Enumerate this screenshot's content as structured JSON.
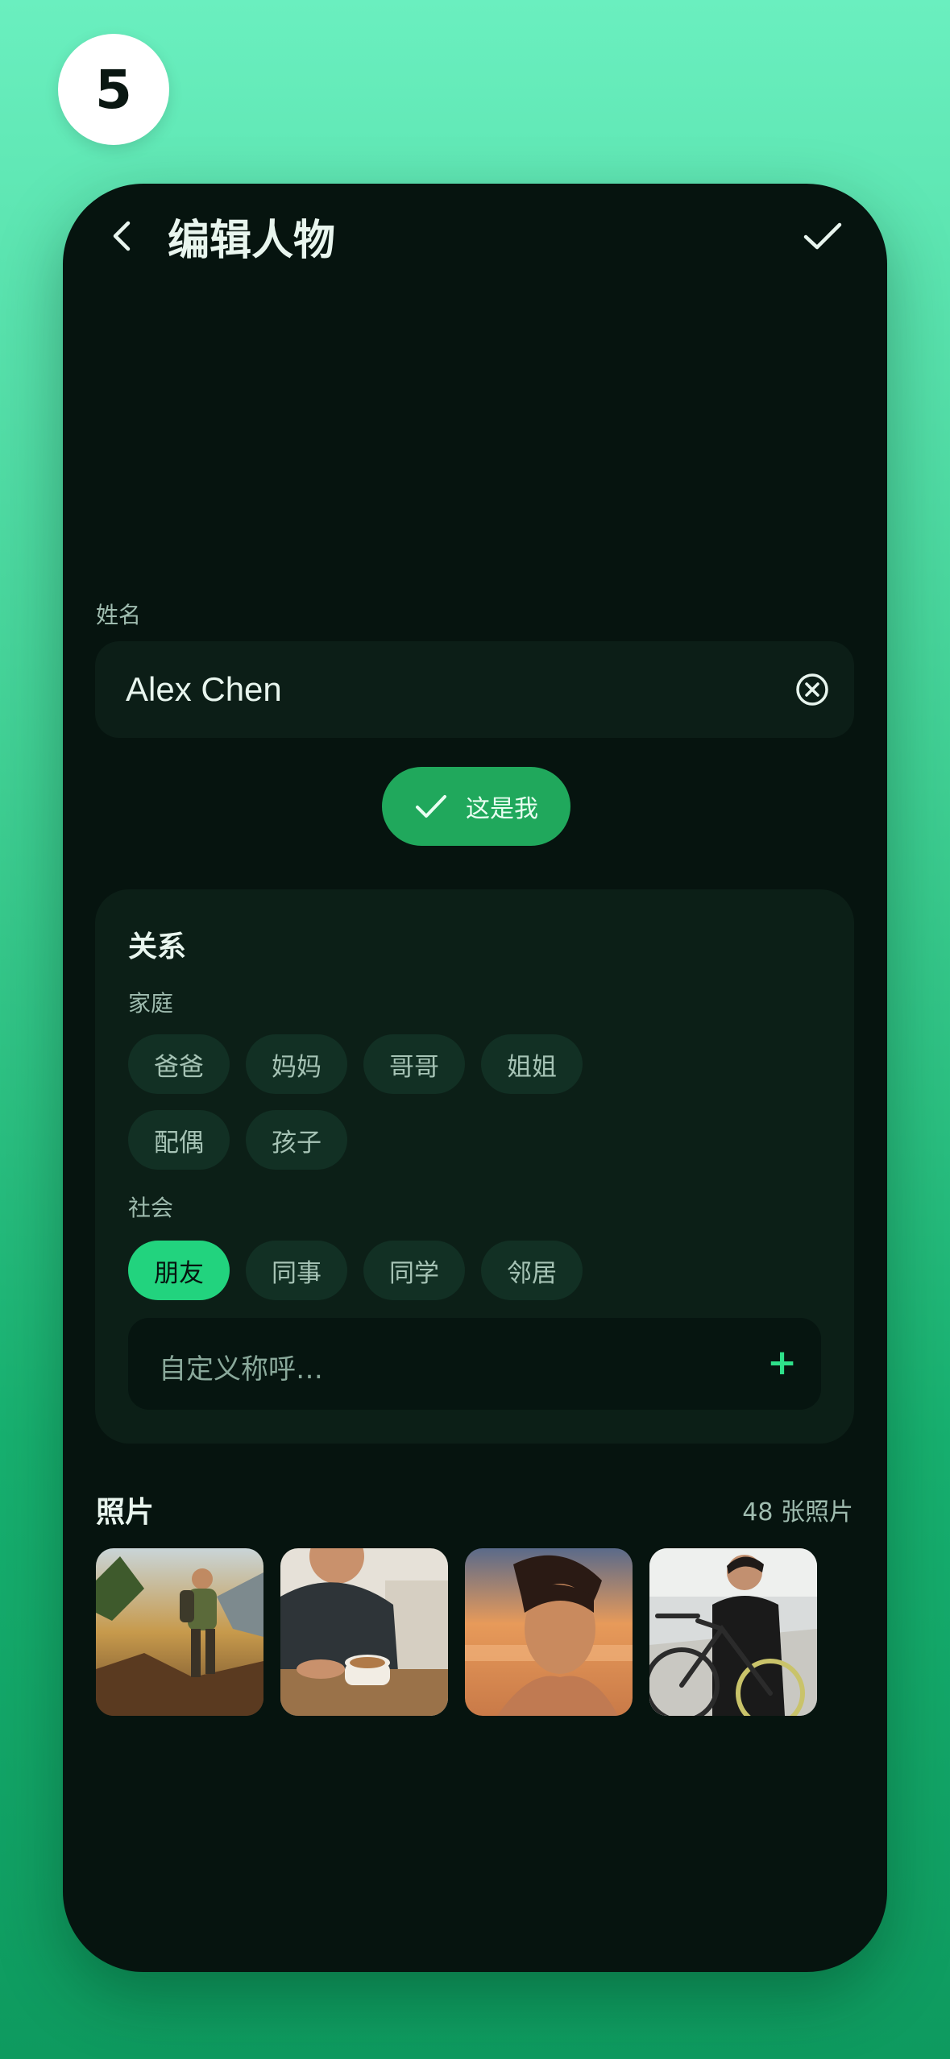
{
  "step": "5",
  "header": {
    "title": "编辑人物",
    "back_icon": "chevron-left-icon",
    "confirm_icon": "check-icon"
  },
  "name_section": {
    "label": "姓名",
    "value": "Alex Chen",
    "clear_icon": "clear-circle-icon"
  },
  "this_is_me_button": {
    "label": "这是我",
    "icon": "check-icon"
  },
  "relationship": {
    "title": "关系",
    "family": {
      "label": "家庭",
      "chips": [
        "爸爸",
        "妈妈",
        "哥哥",
        "姐姐",
        "配偶",
        "孩子"
      ]
    },
    "social": {
      "label": "社会",
      "chips": [
        "朋友",
        "同事",
        "同学",
        "邻居"
      ],
      "selected": "朋友"
    },
    "custom": {
      "placeholder": "自定义称呼…",
      "add_label": "+"
    }
  },
  "photos": {
    "title": "照片",
    "count": "48 张照片",
    "items": [
      "hiking-photo",
      "coffee-photo",
      "beach-sunset-photo",
      "bicycle-photo"
    ]
  },
  "colors": {
    "accent": "#22d37e",
    "primary_button": "#20a85c",
    "screen_bg": "#06140f",
    "card_bg": "#0c1f17"
  }
}
